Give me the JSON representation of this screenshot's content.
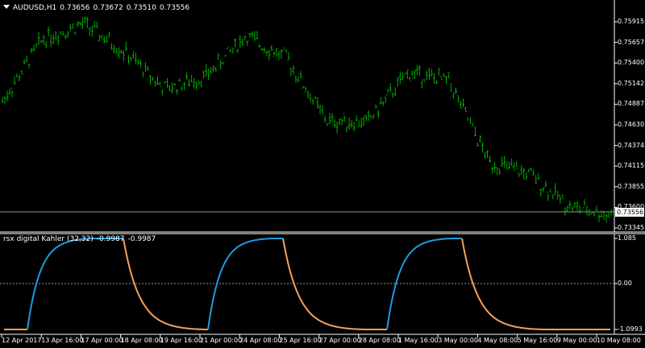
{
  "main_chart": {
    "symbol": "AUDUSD,H1",
    "open": "0.73656",
    "high": "0.73672",
    "low": "0.73510",
    "close": "0.73556",
    "price_labels": [
      "0.75915",
      "0.75657",
      "0.75400",
      "0.75142",
      "0.74887",
      "0.74630",
      "0.74374",
      "0.74115",
      "0.73855",
      "0.73600",
      "0.73345"
    ],
    "current_price": "0.73556",
    "bar_color": "#00b000"
  },
  "indicator": {
    "title": "rsx digital Kahler (32,32)",
    "value1": "-0.9987",
    "value2": "-0.9987",
    "levels": [
      "1.085",
      "0.00",
      "-1.0993"
    ],
    "up_color": "#1e9be0",
    "down_color": "#f5a05a"
  },
  "time_axis": {
    "labels": [
      "12 Apr 2017",
      "13 Apr 16:00",
      "17 Apr 00:00",
      "18 Apr 08:00",
      "19 Apr 16:00",
      "21 Apr 00:00",
      "24 Apr 08:00",
      "25 Apr 16:00",
      "27 Apr 00:00",
      "28 Apr 08:00",
      "1 May 16:00",
      "3 May 00:00",
      "4 May 08:00",
      "5 May 16:00",
      "9 May 00:00",
      "10 May 08:00"
    ]
  },
  "chart_data": {
    "type": "line",
    "title": "AUDUSD,H1",
    "series": [
      {
        "name": "AUDUSD,H1",
        "x": [
          "12 Apr 2017",
          "13 Apr 16:00",
          "17 Apr 00:00",
          "18 Apr 08:00",
          "19 Apr 16:00",
          "21 Apr 00:00",
          "24 Apr 08:00",
          "25 Apr 16:00",
          "27 Apr 00:00",
          "28 Apr 08:00",
          "1 May 16:00",
          "3 May 00:00",
          "4 May 08:00",
          "5 May 16:00",
          "9 May 00:00",
          "10 May 08:00"
        ],
        "values": [
          0.7495,
          0.7572,
          0.759,
          0.7556,
          0.751,
          0.7525,
          0.7575,
          0.7548,
          0.747,
          0.747,
          0.753,
          0.752,
          0.742,
          0.7405,
          0.7365,
          0.7356
        ]
      },
      {
        "name": "rsx digital Kahler (32,32)",
        "x": [
          "12 Apr 2017",
          "13 Apr 16:00",
          "17 Apr 00:00",
          "18 Apr 08:00",
          "19 Apr 16:00",
          "21 Apr 00:00",
          "24 Apr 08:00",
          "25 Apr 16:00",
          "27 Apr 00:00",
          "28 Apr 08:00",
          "1 May 16:00",
          "3 May 00:00",
          "4 May 08:00",
          "5 May 16:00",
          "9 May 00:00",
          "10 May 08:00"
        ],
        "values": [
          -1.099,
          0.6,
          1.07,
          1.085,
          -0.7,
          -1.099,
          0.9,
          1.085,
          -0.6,
          -1.099,
          0.7,
          1.085,
          -0.4,
          -1.05,
          -1.099,
          -1.099
        ]
      }
    ],
    "ylim": [
      0.73345,
      0.76172
    ],
    "indicator_ylim": [
      -1.0993,
      1.085
    ]
  }
}
